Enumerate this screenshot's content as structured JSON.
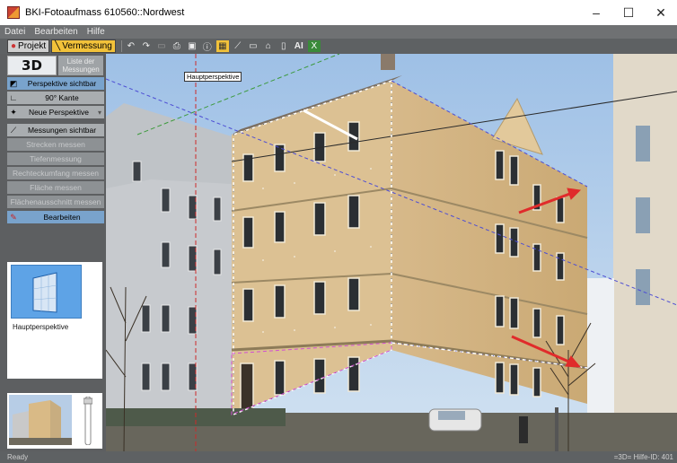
{
  "window": {
    "title": "BKI-Fotoaufmass 610560::Nordwest",
    "minimize": "–",
    "maximize": "☐",
    "close": "✕"
  },
  "menu": [
    "Datei",
    "Bearbeiten",
    "Hilfe"
  ],
  "toolbar": {
    "projekt_label": "Projekt",
    "vermessung_label": "Vermessung",
    "icons": [
      "undo-icon",
      "redo-icon",
      "save-icon",
      "print-icon",
      "image-export-icon",
      "info-icon",
      "grid-toggle-icon",
      "line-tool-icon",
      "rectangle-tool-icon",
      "house-icon",
      "door-icon",
      "text-tool-icon",
      "excel-icon"
    ]
  },
  "left_panel": {
    "btn_3d": "3D",
    "btn_liste": "Liste der Messungen",
    "rows": {
      "perspektive_sichtbar": "Perspektive sichtbar",
      "kante_90": "90° Kante",
      "neue_perspektive": "Neue Perspektive",
      "messungen_sichtbar": "Messungen sichtbar",
      "strecken_messen": "Strecken messen",
      "tiefenmessung": "Tiefenmessung",
      "rechteckumfang_messen": "Rechteckumfang messen",
      "flaeche_messen": "Fläche messen",
      "flaechenausschnitt_messen": "Flächenausschnitt messen",
      "bearbeiten": "Bearbeiten"
    },
    "thumbnail_label": "Hauptperspektive"
  },
  "canvas": {
    "tooltip": "Hauptperspektive"
  },
  "status": {
    "left": "Ready",
    "right": "=3D=  Hilfe-ID: 401"
  },
  "colors": {
    "accent_blue": "#79a3cc",
    "vermessung_tab": "#f2c23a",
    "chrome_dark": "#5e6163",
    "facade": "#dcc193",
    "arrow_red": "#e02b2b"
  }
}
